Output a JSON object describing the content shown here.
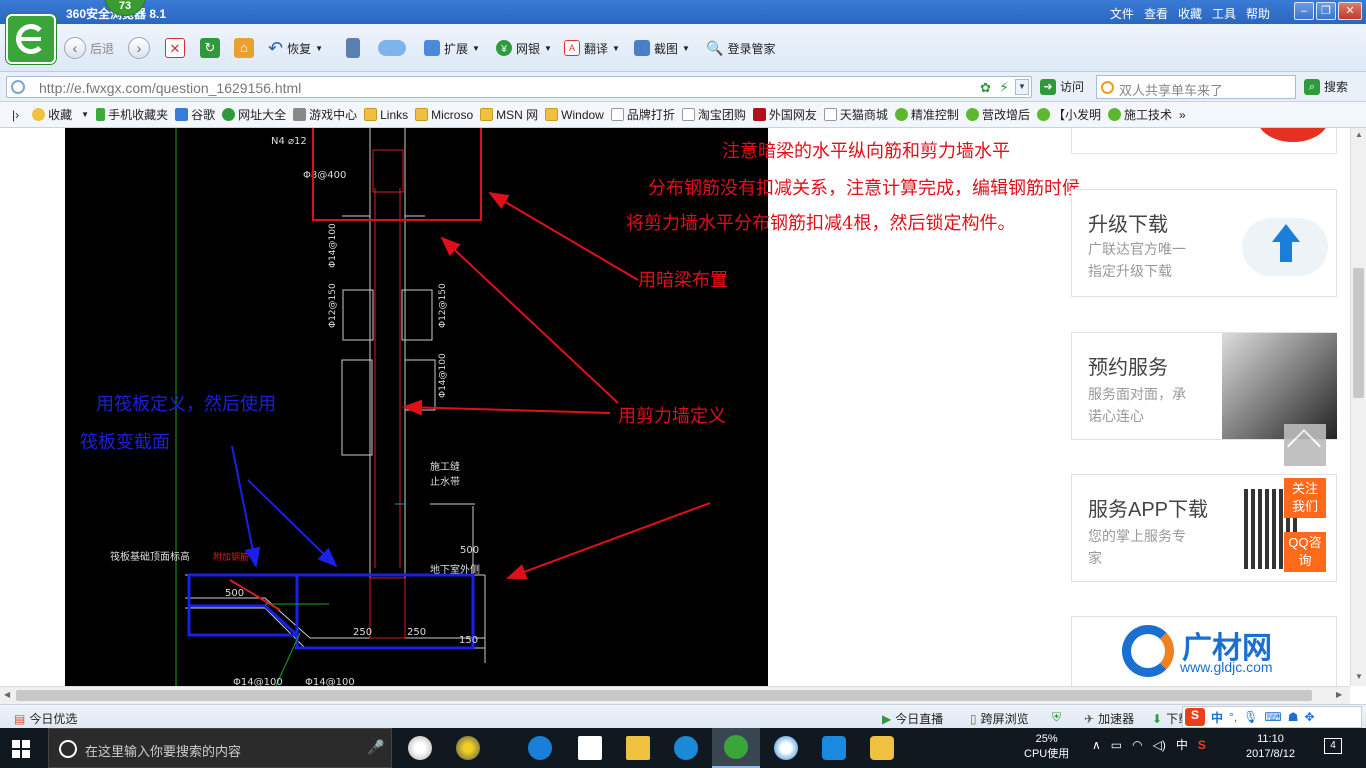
{
  "window": {
    "title": "360安全浏览器 8.1",
    "badge": "73",
    "menu": [
      "文件",
      "查看",
      "收藏",
      "工具",
      "帮助"
    ],
    "buttons": [
      "–",
      "❐",
      "✕"
    ]
  },
  "toolbar": {
    "back": "后退",
    "restore": "恢复",
    "extensions": "扩展",
    "netbank": "网银",
    "translate": "翻译",
    "screenshot": "截图",
    "login": "登录管家"
  },
  "address": {
    "url": "http://e.fwxgx.com/question_1629156.html",
    "visit": "访问",
    "search_placeholder": "双人共享单车来了",
    "search_btn": "搜索"
  },
  "bookmarks": [
    "收藏",
    "手机收藏夹",
    "谷歌",
    "网址大全",
    "游戏中心",
    "Links",
    "Microso",
    "MSN 网",
    "Window",
    "品牌打折",
    "淘宝团购",
    "外国网友",
    "天猫商城",
    "精准控制",
    "营改增后",
    "【小发明",
    "施工技术"
  ],
  "annotations": {
    "red1": "注意暗梁的水平纵向筋和剪力墙水平",
    "red2": "分布钢筋没有扣减关系，注意计算完成，编辑钢筋时候",
    "red3": "将剪力墙水平分布钢筋扣减4根，然后锁定构件。",
    "red4": "用暗梁布置",
    "red5": "用剪力墙定义",
    "blue1": "用筏板定义，然后使用",
    "blue2": "筏板变截面"
  },
  "cad": {
    "labels": [
      "N4 ⌀12",
      "Φ8@400",
      "Φ14@100",
      "Φ12@150",
      "Φ12@150",
      "Φ14@100",
      "施工缝",
      "止水带",
      "地下室外侧",
      "筏板基础顶面标高",
      "500",
      "250",
      "250",
      "150",
      "500",
      "Φ14@100",
      "Φ14@100",
      "附加钢筋"
    ]
  },
  "sidebar": {
    "upgrade_title": "升级下载",
    "upgrade_sub1": "广联达官方唯一",
    "upgrade_sub2": "指定升级下载",
    "service_title": "预约服务",
    "service_sub1": "服务面对面，承",
    "service_sub2": "诺心连心",
    "app_title": "服务APP下载",
    "app_sub1": "您的掌上服务专",
    "app_sub2": "家",
    "gldjc_brand": "广材网",
    "gldjc_url": "www.gldjc.com",
    "follow": "关注我们",
    "qq": "QQ咨询"
  },
  "statusbar": {
    "today": "今日优选",
    "live": "今日直播",
    "crossscreen": "跨屏浏览",
    "accelerator": "加速器",
    "download": "下载"
  },
  "taskbar": {
    "search_placeholder": "在这里输入你要搜索的内容",
    "cpu_percent": "25%",
    "cpu_label": "CPU使用",
    "ime": "中",
    "time": "11:10",
    "date": "2017/8/12",
    "notifications": "4"
  },
  "colors": {
    "accent": "#2a66c0",
    "annotation_red": "#e0101a",
    "annotation_blue": "#1a20d8",
    "orange": "#ff6a1a"
  }
}
